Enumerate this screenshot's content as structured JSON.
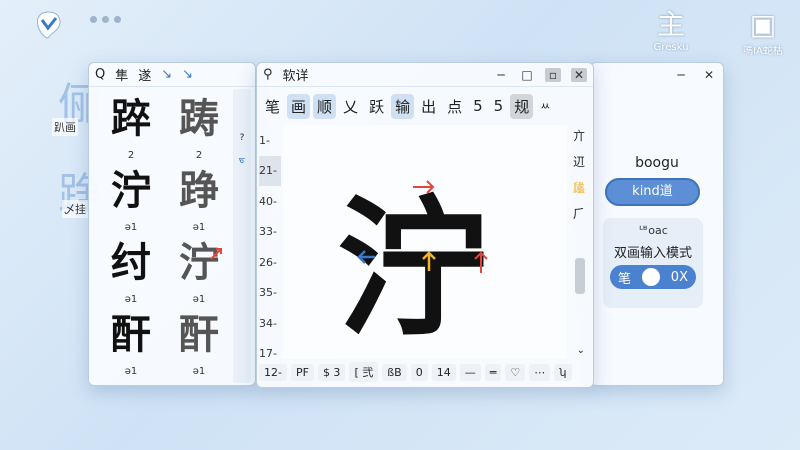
{
  "desktop": {
    "dots": [
      "",
      "",
      ""
    ],
    "icons": [
      {
        "glyph": "主",
        "label": "Gresku"
      },
      {
        "glyph": "▣",
        "label": "嗎IA蛇枯"
      }
    ],
    "bg_chars": [
      {
        "char": "俪",
        "label": "趴画"
      },
      {
        "char": "踭",
        "label": "乄挂"
      }
    ]
  },
  "left_window": {
    "toolbar": [
      "Q",
      "隼",
      "遂",
      "↘",
      "↘"
    ],
    "chars": [
      {
        "char": "踤",
        "num": "2"
      },
      {
        "char": "踌",
        "num": "2"
      },
      {
        "char": "泞",
        "num": "ə1"
      },
      {
        "char": "踭",
        "num": "ə1"
      },
      {
        "char": "纣",
        "num": "ə1"
      },
      {
        "char": "泞",
        "num": "ə1"
      },
      {
        "char": "酐",
        "num": "ə1"
      },
      {
        "char": "酐",
        "num": "ə1"
      }
    ],
    "side_markers": [
      "?",
      "ᠳ"
    ]
  },
  "main_window": {
    "title": "软详",
    "toolbar": [
      "笔",
      "画",
      "顺",
      "乂",
      "跃",
      "输",
      "出",
      "点",
      "5",
      "5",
      "规",
      "ㅆ"
    ],
    "line_numbers": [
      "1-",
      "21-",
      "40-",
      "33-",
      "26-",
      "35-",
      "34-",
      "17-",
      "12-"
    ],
    "big_char": "泞",
    "right_tools": [
      "亣",
      "䢋",
      "㼖",
      "⺁"
    ],
    "bottom_bar": [
      "PF",
      "$ 3",
      "[ 弐",
      "ßB",
      "0",
      "14",
      "—",
      "═",
      "♡",
      "⋯",
      "ʮ"
    ]
  },
  "right_panel": {
    "title": "boogu",
    "brand_button": "kind道",
    "mode_small": "ᄖoac",
    "mode_title": "双画输入模式",
    "toggle_left": "笔",
    "toggle_right": "0X"
  },
  "colors": {
    "accent": "#4a82cf",
    "arrow_red": "#e2473c",
    "arrow_yellow": "#f2b52a",
    "arrow_blue": "#3a78c8"
  }
}
